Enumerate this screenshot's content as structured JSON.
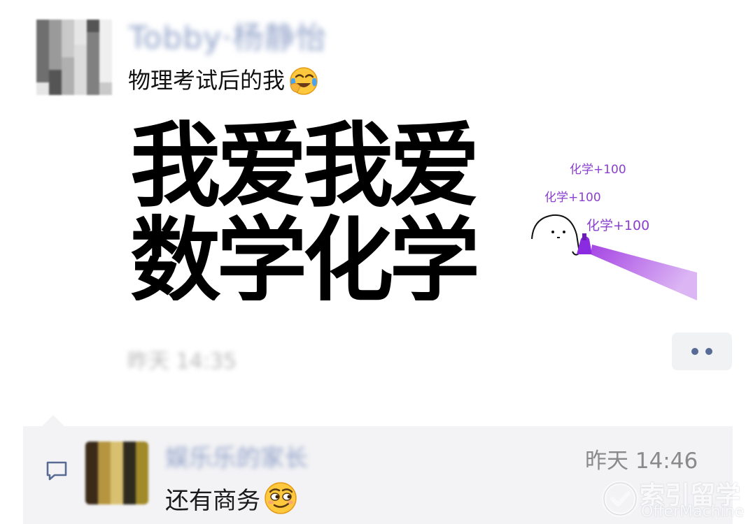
{
  "post": {
    "author_name": "Tobby·杨静怡",
    "text": "物理考试后的我",
    "emoji_icon": "face-with-tears-of-joy-icon",
    "time": "昨天 14:35",
    "more_icon": "more-dots-icon"
  },
  "meme": {
    "line1": "我爱我爱",
    "line2": "数学化学",
    "tags": [
      "化学+100",
      "化学+100",
      "化学+100"
    ],
    "spray_color": "#9b30e0"
  },
  "comment": {
    "icon": "comment-icon",
    "commenter_name": "娱乐乐的家长",
    "time": "昨天 14:46",
    "text": "还有商务",
    "emoji_icon": "smirking-face-icon"
  },
  "watermark": {
    "cn": "索引留学",
    "en": "OfferMachine"
  },
  "colors": {
    "name_blue": "#576b95",
    "comment_bg": "#f3f3f5",
    "time_gray": "#8a8a8a"
  }
}
